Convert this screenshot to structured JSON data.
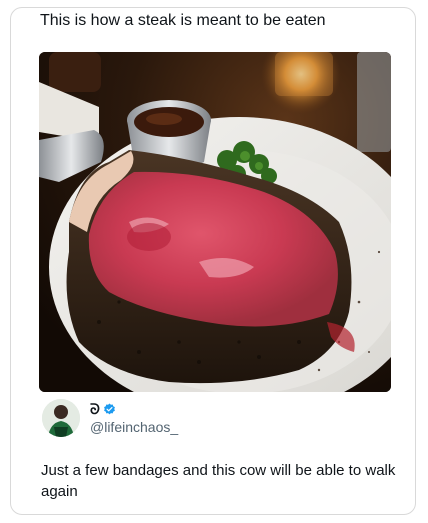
{
  "post": {
    "caption": "This is how a steak is meant to be eaten",
    "image_alt": "steak-photo"
  },
  "reply": {
    "author_name": "ᘐ",
    "handle": "@lifeinchaos_",
    "text": "Just a few bandages and this cow will be able to walk again",
    "verified_color": "#1d9bf0"
  }
}
